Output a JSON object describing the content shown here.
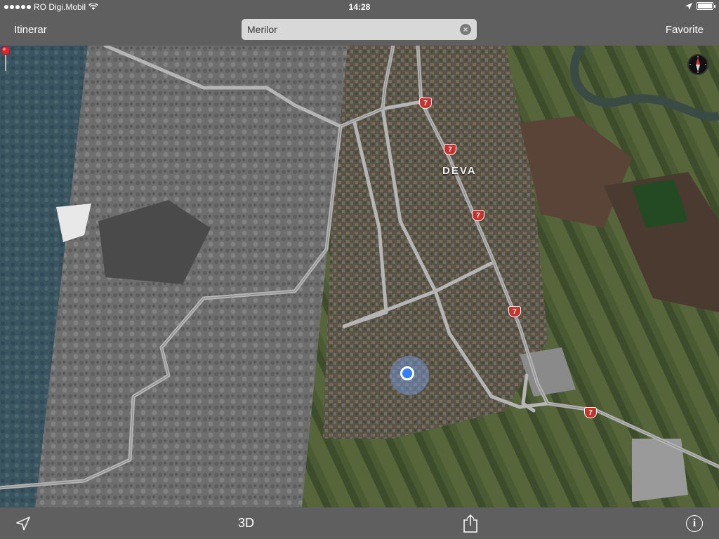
{
  "status_bar": {
    "carrier": "RO Digi.Mobil",
    "time": "14:28"
  },
  "nav_bar": {
    "left_label": "Itinerar",
    "right_label": "Favorite",
    "search_value": "Merilor"
  },
  "map": {
    "city_label": "Deva",
    "route_shields": [
      "7",
      "7",
      "7",
      "7",
      "7"
    ],
    "view_mode": "satellite",
    "colors": {
      "pin": "#e0242b",
      "user_location": "#2f80ff",
      "route_shield": "#c8322c"
    }
  },
  "toolbar": {
    "location_icon": "location-arrow-icon",
    "toggle_3d_label": "3D",
    "share_icon": "share-icon",
    "info_icon": "info-icon",
    "info_glyph": "i"
  }
}
